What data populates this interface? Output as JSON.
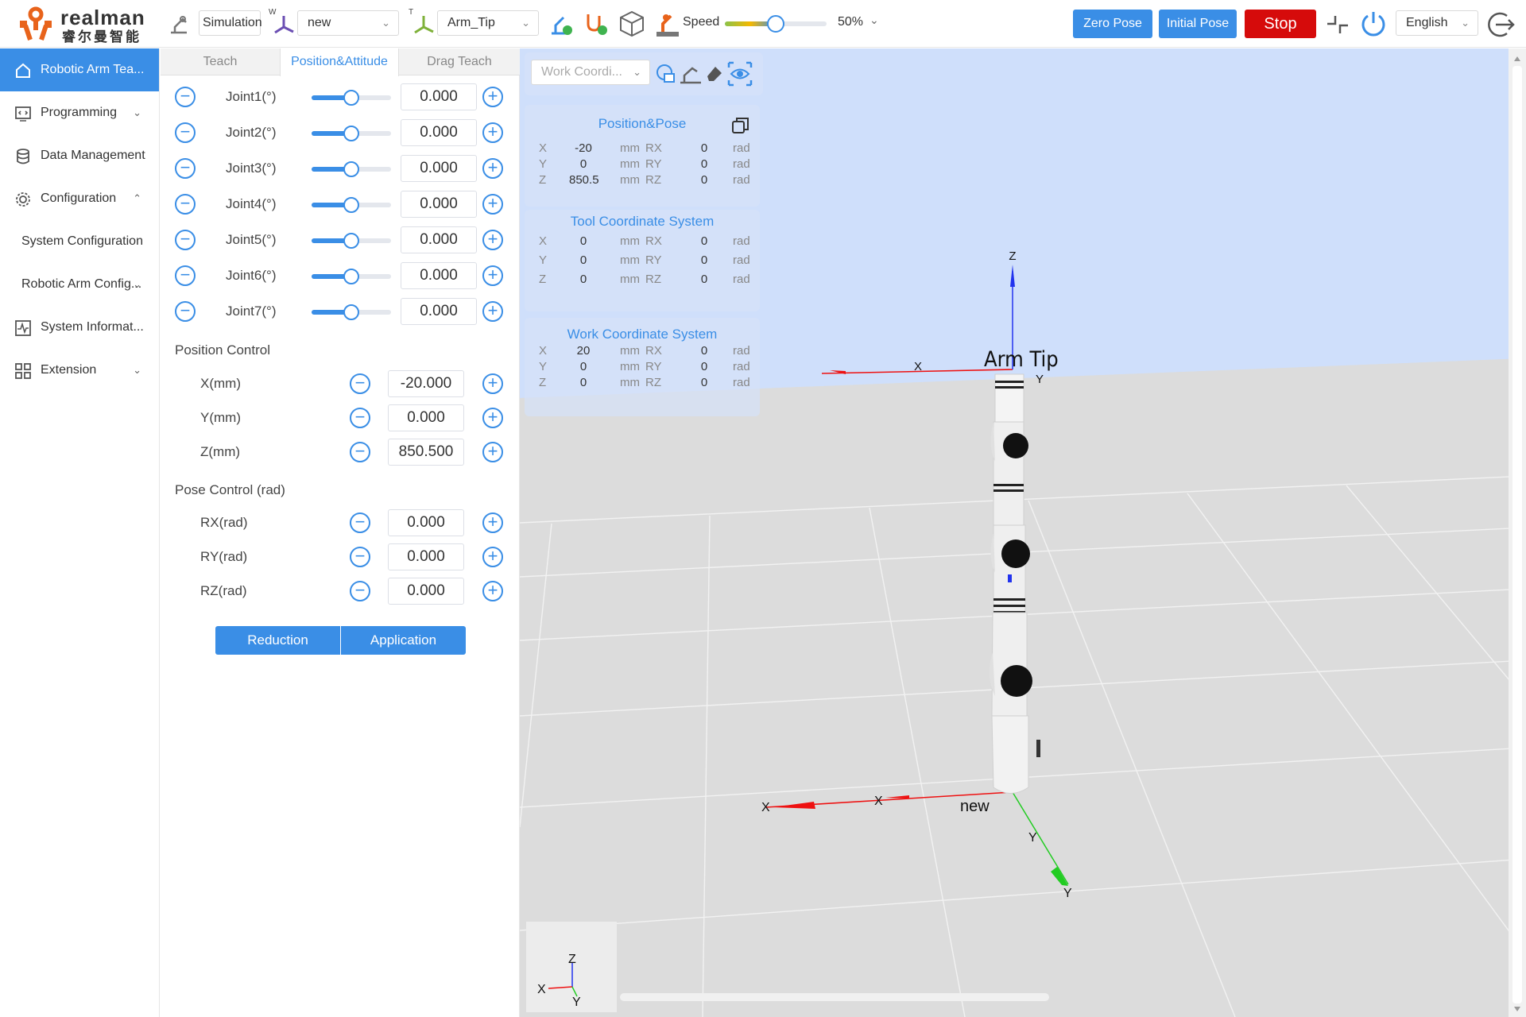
{
  "brand": {
    "name_en": "realman",
    "name_cn": "睿尔曼智能",
    "color": "#e8631b"
  },
  "toolbar": {
    "mode_label": "Simulation",
    "work_frame_select": "new",
    "tool_frame_select": "Arm_Tip",
    "speed_label": "Speed",
    "speed_value": "50%",
    "speed_fraction": 0.5,
    "zero_pose": "Zero Pose",
    "initial_pose": "Initial Pose",
    "stop": "Stop",
    "language": "English",
    "work_superscript": "W",
    "tool_superscript": "T"
  },
  "sidebar": {
    "items": [
      {
        "label": "Robotic Arm Tea...",
        "icon": "home-icon",
        "active": true
      },
      {
        "label": "Programming",
        "icon": "code-icon",
        "chevron": "down"
      },
      {
        "label": "Data Management",
        "icon": "database-icon"
      },
      {
        "label": "Configuration",
        "icon": "gear-icon",
        "chevron": "up"
      },
      {
        "label": "System Configuration",
        "sub": true
      },
      {
        "label": "Robotic Arm Config...",
        "sub": true,
        "chevron": "down"
      },
      {
        "label": "System Informat...",
        "icon": "pulse-icon"
      },
      {
        "label": "Extension",
        "icon": "grid-icon",
        "chevron": "down"
      }
    ]
  },
  "panel": {
    "tabs": [
      "Teach",
      "Position&Attitude",
      "Drag Teach"
    ],
    "active_tab": 1,
    "joints": [
      {
        "label": "Joint1(°)",
        "value": "0.000",
        "slider_fraction": 0.5
      },
      {
        "label": "Joint2(°)",
        "value": "0.000",
        "slider_fraction": 0.5
      },
      {
        "label": "Joint3(°)",
        "value": "0.000",
        "slider_fraction": 0.5
      },
      {
        "label": "Joint4(°)",
        "value": "0.000",
        "slider_fraction": 0.5
      },
      {
        "label": "Joint5(°)",
        "value": "0.000",
        "slider_fraction": 0.5
      },
      {
        "label": "Joint6(°)",
        "value": "0.000",
        "slider_fraction": 0.5
      },
      {
        "label": "Joint7(°)",
        "value": "0.000",
        "slider_fraction": 0.5
      }
    ],
    "position_title": "Position Control",
    "position": [
      {
        "label": "X(mm)",
        "value": "-20.000"
      },
      {
        "label": "Y(mm)",
        "value": "0.000"
      },
      {
        "label": "Z(mm)",
        "value": "850.500"
      }
    ],
    "pose_title": "Pose Control (rad)",
    "pose": [
      {
        "label": "RX(rad)",
        "value": "0.000"
      },
      {
        "label": "RY(rad)",
        "value": "0.000"
      },
      {
        "label": "RZ(rad)",
        "value": "0.000"
      }
    ],
    "reduction": "Reduction",
    "application": "Application"
  },
  "view": {
    "coord_select": "Work Coordi...",
    "position_pose": {
      "title": "Position&Pose",
      "rows": [
        {
          "axis": "X",
          "value": "-20",
          "unit": "mm",
          "raxis": "RX",
          "rvalue": "0",
          "runit": "rad"
        },
        {
          "axis": "Y",
          "value": "0",
          "unit": "mm",
          "raxis": "RY",
          "rvalue": "0",
          "runit": "rad"
        },
        {
          "axis": "Z",
          "value": "850.5",
          "unit": "mm",
          "raxis": "RZ",
          "rvalue": "0",
          "runit": "rad"
        }
      ]
    },
    "tool_cs": {
      "title": "Tool Coordinate System",
      "rows": [
        {
          "axis": "X",
          "value": "0",
          "unit": "mm",
          "raxis": "RX",
          "rvalue": "0",
          "runit": "rad"
        },
        {
          "axis": "Y",
          "value": "0",
          "unit": "mm",
          "raxis": "RY",
          "rvalue": "0",
          "runit": "rad"
        },
        {
          "axis": "Z",
          "value": "0",
          "unit": "mm",
          "raxis": "RZ",
          "rvalue": "0",
          "runit": "rad"
        }
      ]
    },
    "work_cs": {
      "title": "Work Coordinate System",
      "rows": [
        {
          "axis": "X",
          "value": "20",
          "unit": "mm",
          "raxis": "RX",
          "rvalue": "0",
          "runit": "rad"
        },
        {
          "axis": "Y",
          "value": "0",
          "unit": "mm",
          "raxis": "RY",
          "rvalue": "0",
          "runit": "rad"
        },
        {
          "axis": "Z",
          "value": "0",
          "unit": "mm",
          "raxis": "RZ",
          "rvalue": "0",
          "runit": "rad"
        }
      ]
    },
    "labels": {
      "tool_frame": "Arm Tip",
      "work_frame": "new",
      "x": "X",
      "y": "Y",
      "z": "Z"
    }
  }
}
